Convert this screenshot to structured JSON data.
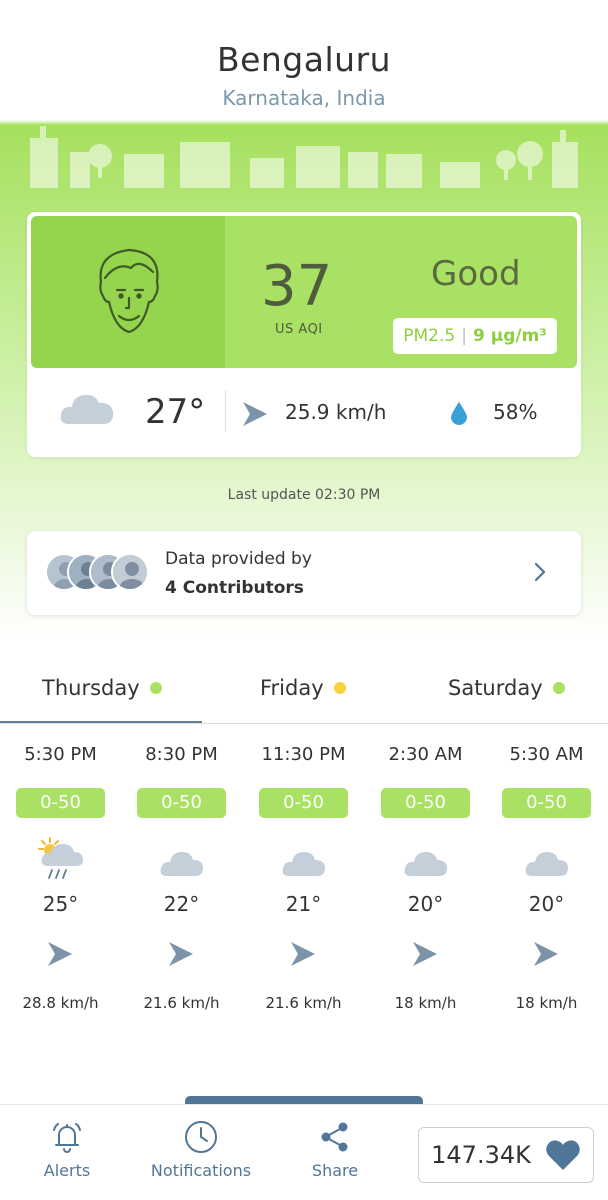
{
  "location": {
    "city": "Bengaluru",
    "region": "Karnataka, India"
  },
  "aqi": {
    "value": "37",
    "unit": "US AQI",
    "level": "Good",
    "pollutant": "PM2.5",
    "pollutant_value": "9 µg/m³",
    "face_icon": "smiling-face-icon"
  },
  "current_weather": {
    "condition_icon": "cloud-icon",
    "temperature": "27°",
    "wind_speed": "25.9 km/h",
    "humidity": "58%"
  },
  "last_update": "Last update 02:30 PM",
  "contributors": {
    "line1": "Data provided by",
    "line2": "4 Contributors"
  },
  "colors": {
    "good_green": "#a8e163",
    "moderate_yellow": "#f7d23c",
    "accent_blue": "#4f7699"
  },
  "day_tabs": [
    {
      "label": "Thursday",
      "dot_color": "#a8e163",
      "active": true
    },
    {
      "label": "Friday",
      "dot_color": "#f7d23c",
      "active": false
    },
    {
      "label": "Saturday",
      "dot_color": "#a8e163",
      "active": false
    }
  ],
  "hourly": [
    {
      "time": "5:30 PM",
      "aqi_range": "0-50",
      "icon": "sun-cloud-rain-icon",
      "temp": "25°",
      "wind": "28.8 km/h"
    },
    {
      "time": "8:30 PM",
      "aqi_range": "0-50",
      "icon": "cloud-icon",
      "temp": "22°",
      "wind": "21.6 km/h"
    },
    {
      "time": "11:30 PM",
      "aqi_range": "0-50",
      "icon": "cloud-icon",
      "temp": "21°",
      "wind": "21.6 km/h"
    },
    {
      "time": "2:30 AM",
      "aqi_range": "0-50",
      "icon": "cloud-icon",
      "temp": "20°",
      "wind": "18 km/h"
    },
    {
      "time": "5:30 AM",
      "aqi_range": "0-50",
      "icon": "cloud-icon",
      "temp": "20°",
      "wind": "18 km/h"
    }
  ],
  "bottom_nav": {
    "alerts": "Alerts",
    "notifications": "Notifications",
    "share": "Share",
    "likes": "147.34K"
  }
}
